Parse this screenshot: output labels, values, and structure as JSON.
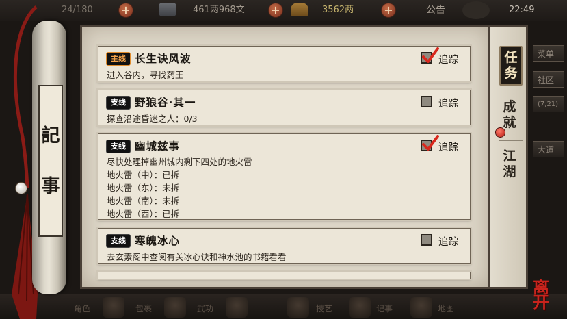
{
  "topbar": {
    "stamina": "24/180",
    "cash": "461两968文",
    "gold": "3562两",
    "announcement": "公告",
    "clock": "22:49"
  },
  "side_menu": [
    "菜单",
    "社区",
    "(7,21)",
    "大道"
  ],
  "scroll": {
    "label_top": "記",
    "label_bottom": "事"
  },
  "tabs": [
    {
      "label": "任务",
      "active": true
    },
    {
      "label": "成就",
      "active": false,
      "badge": true
    },
    {
      "label": "江湖",
      "active": false
    }
  ],
  "track_label": "追踪",
  "quests": [
    {
      "type": "main",
      "tag": "主线",
      "title": "长生诀风波",
      "desc": "进入谷内，寻找药王",
      "tracked": true,
      "sub": []
    },
    {
      "type": "side",
      "tag": "支线",
      "title": "野狼谷·其一",
      "desc": "探查沿途昏迷之人：0/3",
      "tracked": false,
      "sub": []
    },
    {
      "type": "side",
      "tag": "支线",
      "title": "幽城兹事",
      "desc": "尽快处理掉幽州城内剩下四处的地火雷",
      "tracked": true,
      "sub": [
        "地火雷（中）：已拆",
        "地火雷（东）：未拆",
        "地火雷（南）：未拆",
        "地火雷（西）：已拆"
      ]
    },
    {
      "type": "side",
      "tag": "支线",
      "title": "寒魄冰心",
      "desc": "去玄素阁中查阅有关冰心诀和神水池的书籍看看",
      "tracked": false,
      "sub": []
    }
  ],
  "bottom_bar": [
    "角色",
    "包裹",
    "武功",
    "技艺",
    "记事",
    "地图"
  ],
  "close_label": "离开"
}
